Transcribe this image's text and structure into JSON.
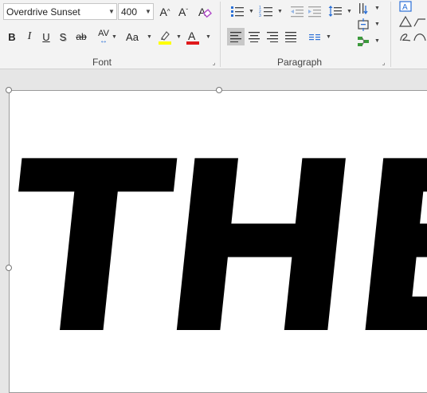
{
  "ribbon": {
    "font_group": {
      "font_name": "Overdrive Sunset",
      "font_size": "400",
      "label": "Font",
      "increase_size": "A^",
      "decrease_size": "Aˇ",
      "bold": "B",
      "italic": "I",
      "underline": "U",
      "shadow": "S",
      "strikethrough": "ab",
      "char_spacing": "AV",
      "change_case": "Aa",
      "highlight_color": "#ffff00",
      "font_color": "#e0191b"
    },
    "paragraph_group": {
      "label": "Paragraph"
    }
  },
  "slide": {
    "text": "THE"
  }
}
